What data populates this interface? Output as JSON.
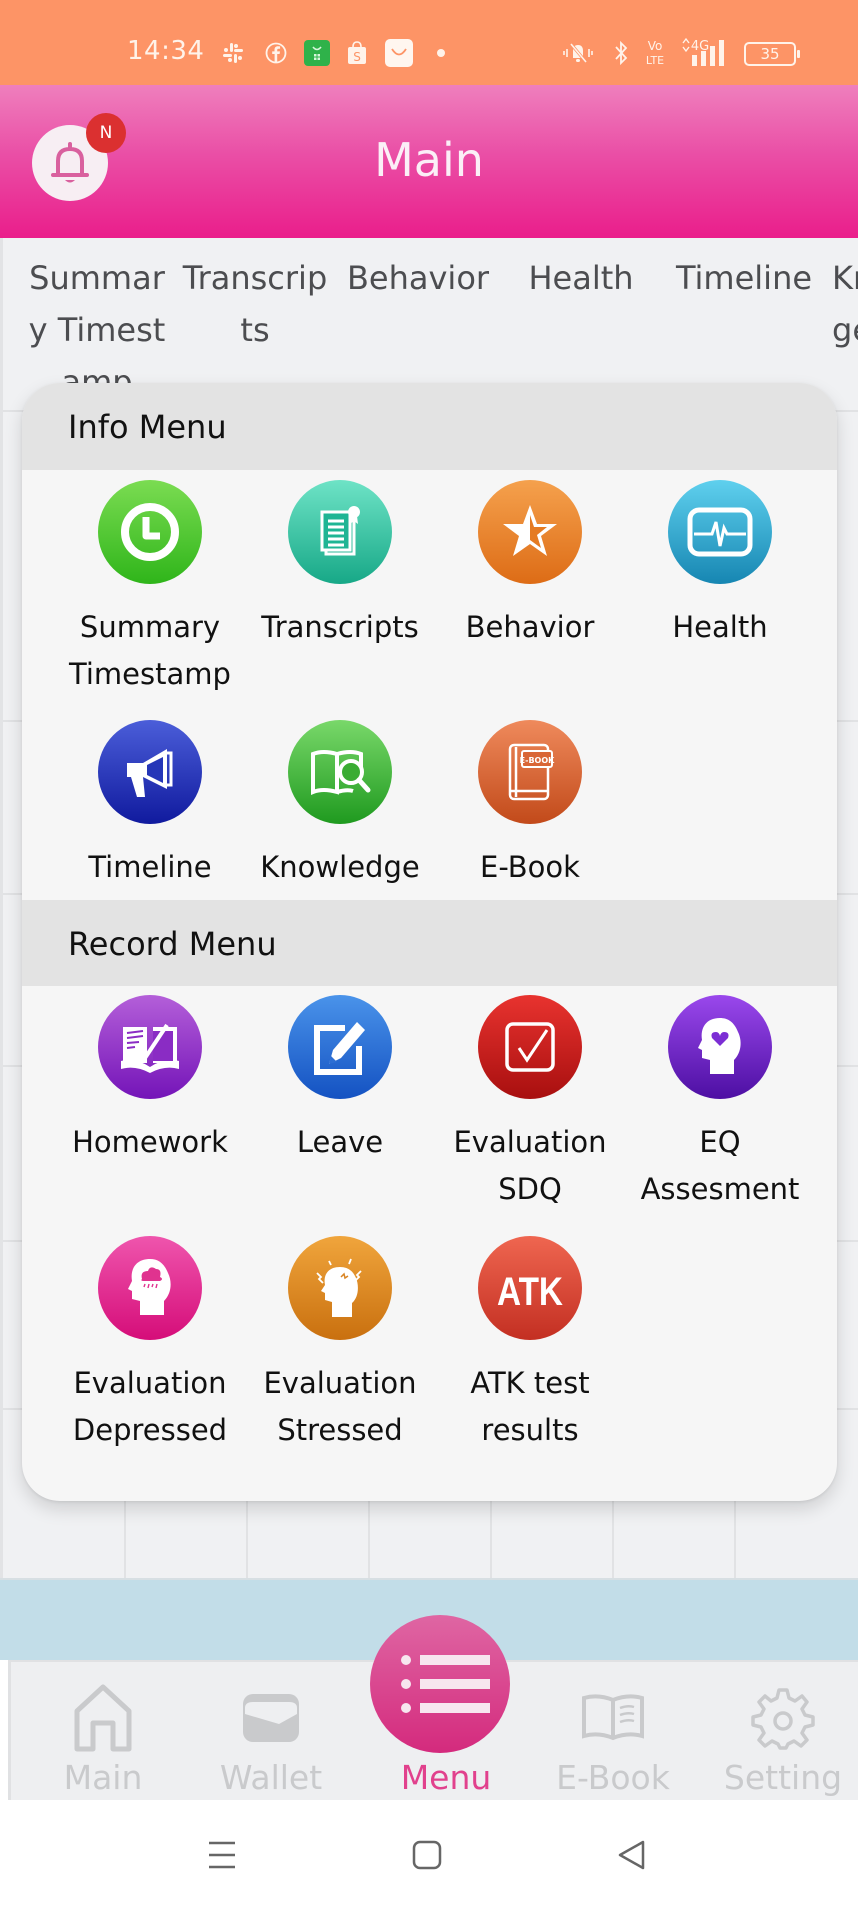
{
  "status_bar": {
    "time": "14:34",
    "notification_icons": [
      "slack-icon",
      "facebook-icon",
      "grab-icon",
      "shopee-icon",
      "lazada-icon",
      "more-dot-icon"
    ],
    "system_icons": [
      "vibrate-mute-icon",
      "bluetooth-icon",
      "volte-icon",
      "4g-signal-icon"
    ],
    "volte_label": "Vo LTE",
    "network_label": "4G",
    "battery": "35"
  },
  "header": {
    "title": "Main",
    "notification_badge": "N"
  },
  "tabs": [
    {
      "label": "Summary Timestamp"
    },
    {
      "label": "Transcripts"
    },
    {
      "label": "Behavior"
    },
    {
      "label": "Health"
    },
    {
      "label": "Timeline"
    },
    {
      "label": "Knowledge"
    }
  ],
  "menu": {
    "info_title": "Info Menu",
    "info_items": [
      {
        "label": "Summary\nTimestamp",
        "icon": "clock-icon",
        "color_top": "#7bdc52",
        "color_bottom": "#2fb51a"
      },
      {
        "label": "Transcripts",
        "icon": "certificate-document-icon",
        "color_top": "#6ee3c6",
        "color_bottom": "#17a887"
      },
      {
        "label": "Behavior",
        "icon": "star-icon",
        "color_top": "#f5a14d",
        "color_bottom": "#dd6c16"
      },
      {
        "label": "Health",
        "icon": "heartbeat-monitor-icon",
        "color_top": "#5fd0ee",
        "color_bottom": "#1686b2"
      },
      {
        "label": "Timeline",
        "icon": "megaphone-icon",
        "color_top": "#4b5ed9",
        "color_bottom": "#101a9e"
      },
      {
        "label": "Knowledge",
        "icon": "book-search-icon",
        "color_top": "#79d86a",
        "color_bottom": "#1f9a1f"
      },
      {
        "label": "E-Book",
        "icon": "ebook-icon",
        "color_top": "#ef8a5c",
        "color_bottom": "#c24a1a",
        "badge_text": "E-BOOK"
      }
    ],
    "record_title": "Record Menu",
    "record_items": [
      {
        "label": "Homework",
        "icon": "homework-book-icon",
        "color_top": "#b45fd9",
        "color_bottom": "#7414b8"
      },
      {
        "label": "Leave",
        "icon": "edit-form-icon",
        "color_top": "#4a93ea",
        "color_bottom": "#1452c2"
      },
      {
        "label": "Evaluation\nSDQ",
        "icon": "checkbox-icon",
        "color_top": "#e8332f",
        "color_bottom": "#a80f0f"
      },
      {
        "label": "EQ\nAssesment",
        "icon": "head-heart-icon",
        "color_top": "#9a48ec",
        "color_bottom": "#4d0fa3"
      },
      {
        "label": "Evaluation\nDepressed",
        "icon": "head-raincloud-icon",
        "color_top": "#ef55ad",
        "color_bottom": "#d50d79"
      },
      {
        "label": "Evaluation\nStressed",
        "icon": "head-stress-icon",
        "color_top": "#f0a53c",
        "color_bottom": "#c9700f"
      },
      {
        "label": "ATK test\nresults",
        "icon": "atk-icon",
        "color_top": "#ef6650",
        "color_bottom": "#c32f22",
        "badge_text": "ATK"
      }
    ]
  },
  "bottom_nav": {
    "items": [
      {
        "label": "Main",
        "icon": "home-icon",
        "active": false
      },
      {
        "label": "Wallet",
        "icon": "wallet-icon",
        "active": false
      },
      {
        "label": "Menu",
        "icon": "menu-list-icon",
        "active": true
      },
      {
        "label": "E-Book",
        "icon": "open-book-icon",
        "active": false
      },
      {
        "label": "Setting",
        "icon": "gear-icon",
        "active": false
      }
    ],
    "active_color": "#e1418d",
    "inactive_color": "#c9cacc"
  },
  "colors": {
    "status_bar": "#fd9466",
    "header_top": "#ef7fbd",
    "header_bottom": "#ea1e8b",
    "badge": "#db3030",
    "blue_band": "#c2dde8"
  }
}
